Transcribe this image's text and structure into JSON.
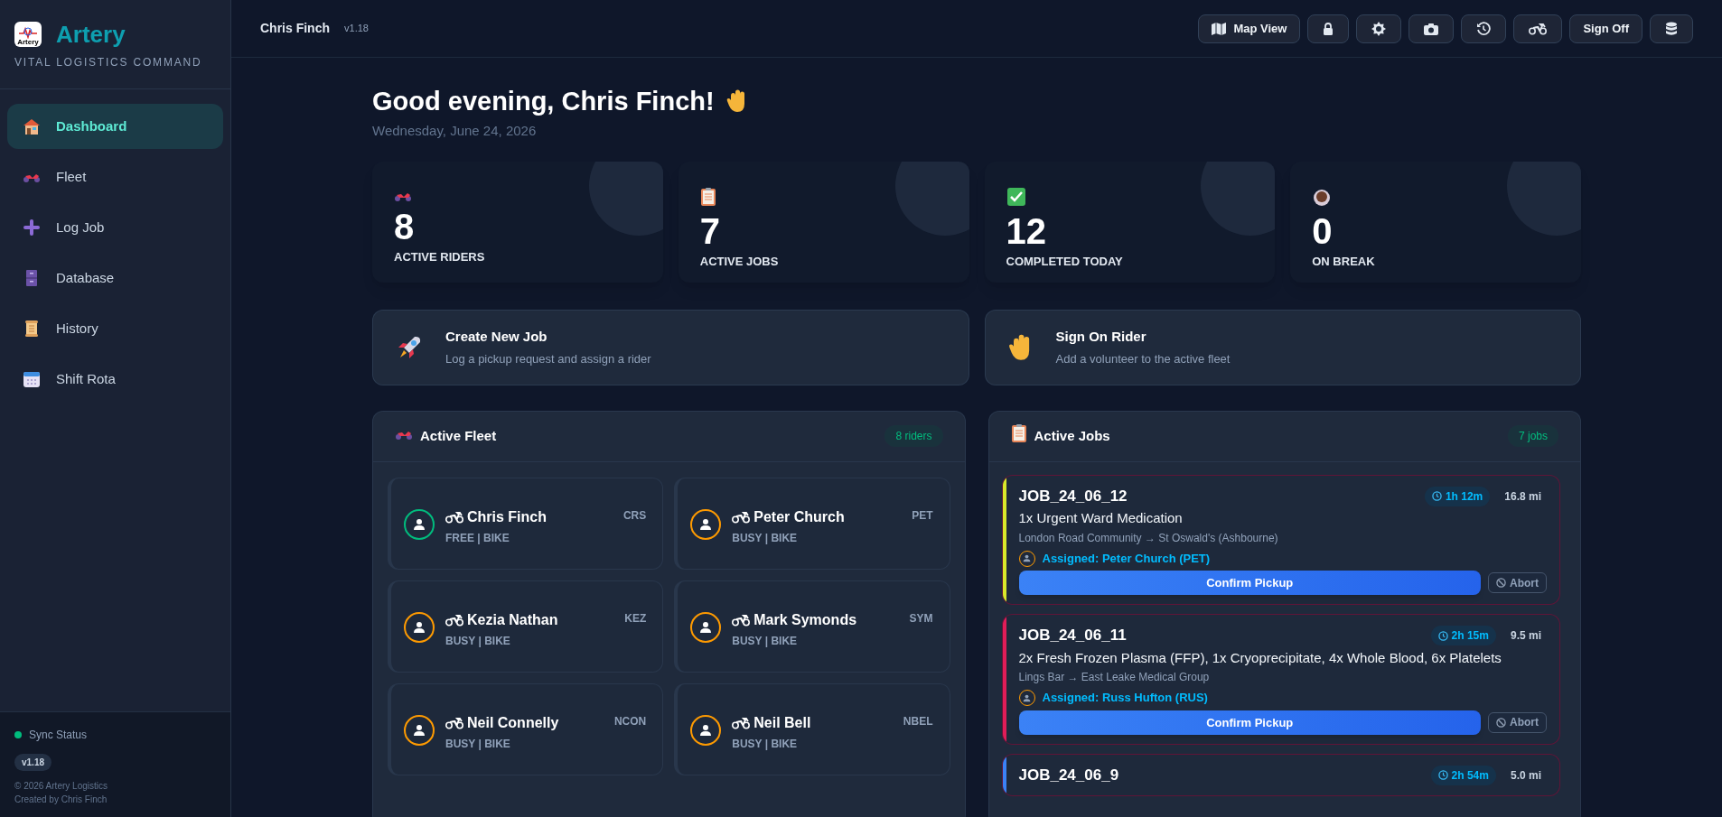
{
  "brand": {
    "name": "Artery",
    "logo_text": "Artery",
    "tagline": "VITAL LOGISTICS COMMAND"
  },
  "nav": [
    {
      "label": "Dashboard",
      "kind": "house",
      "selected": true
    },
    {
      "label": "Fleet",
      "kind": "motorbike",
      "selected": false
    },
    {
      "label": "Log Job",
      "kind": "plus",
      "selected": false
    },
    {
      "label": "Database",
      "kind": "cabinet",
      "selected": false
    },
    {
      "label": "History",
      "kind": "scroll",
      "selected": false
    },
    {
      "label": "Shift Rota",
      "kind": "calendar",
      "selected": false
    }
  ],
  "sidebar_footer": {
    "sync_label": "Sync Status",
    "connected": true,
    "version": "v1.18",
    "copyright": "© 2026 Artery Logistics",
    "credit": "Created by Chris Finch"
  },
  "header": {
    "user": "Chris Finch",
    "version": "v1.18",
    "buttons": [
      {
        "kind": "map",
        "label": "Map View"
      },
      {
        "kind": "lock"
      },
      {
        "kind": "sun"
      },
      {
        "kind": "camera"
      },
      {
        "kind": "history"
      },
      {
        "kind": "bike"
      },
      {
        "kind": "text",
        "label": "Sign Off"
      },
      {
        "kind": "database"
      }
    ]
  },
  "greeting": {
    "title": "Good evening, Chris Finch!",
    "date": "Wednesday, June 24, 2026"
  },
  "stats": [
    {
      "kind": "motorbike",
      "value": "8",
      "label": "ACTIVE RIDERS"
    },
    {
      "kind": "clipboard",
      "value": "7",
      "label": "ACTIVE JOBS"
    },
    {
      "kind": "check",
      "value": "12",
      "label": "COMPLETED TODAY"
    },
    {
      "kind": "cup",
      "value": "0",
      "label": "ON BREAK"
    }
  ],
  "actions": [
    {
      "kind": "rocket",
      "title": "Create New Job",
      "subtitle": "Log a pickup request and assign a rider"
    },
    {
      "kind": "hand",
      "title": "Sign On Rider",
      "subtitle": "Add a volunteer to the active fleet"
    }
  ],
  "fleet": {
    "title": "Active Fleet",
    "count": "8 riders",
    "riders": [
      {
        "name": "Chris Finch",
        "code": "CRS",
        "status": "FREE | BIKE",
        "available": true
      },
      {
        "name": "Peter Church",
        "code": "PET",
        "status": "BUSY | BIKE",
        "available": false
      },
      {
        "name": "Kezia Nathan",
        "code": "KEZ",
        "status": "BUSY | BIKE",
        "available": false
      },
      {
        "name": "Mark Symonds",
        "code": "SYM",
        "status": "BUSY | BIKE",
        "available": false
      },
      {
        "name": "Neil Connelly",
        "code": "NCON",
        "status": "BUSY | BIKE",
        "available": false
      },
      {
        "name": "Neil Bell",
        "code": "NBEL",
        "status": "BUSY | BIKE",
        "available": false
      }
    ]
  },
  "jobs": {
    "title": "Active Jobs",
    "count": "7 jobs",
    "items": [
      {
        "id": "JOB_24_06_12",
        "color": "#d9e82a",
        "elapsed": "1h 12m",
        "distance": "16.8 mi",
        "items": "1x Urgent Ward Medication",
        "route": "London Road Community → St Oswald's (Ashbourne)",
        "assigned": "Assigned: Peter Church (PET)",
        "confirm": "Confirm Pickup",
        "abort": "Abort"
      },
      {
        "id": "JOB_24_06_11",
        "color": "#e11d58",
        "elapsed": "2h 15m",
        "distance": "9.5 mi",
        "items": "2x Fresh Frozen Plasma (FFP), 1x Cryoprecipitate, 4x Whole Blood, 6x Platelets",
        "route": "Lings Bar → East Leake Medical Group",
        "assigned": "Assigned: Russ Hufton (RUS)",
        "confirm": "Confirm Pickup",
        "abort": "Abort"
      },
      {
        "id": "JOB_24_06_9",
        "color": "#3b82f6",
        "elapsed": "2h 54m",
        "distance": "5.0 mi"
      }
    ]
  }
}
